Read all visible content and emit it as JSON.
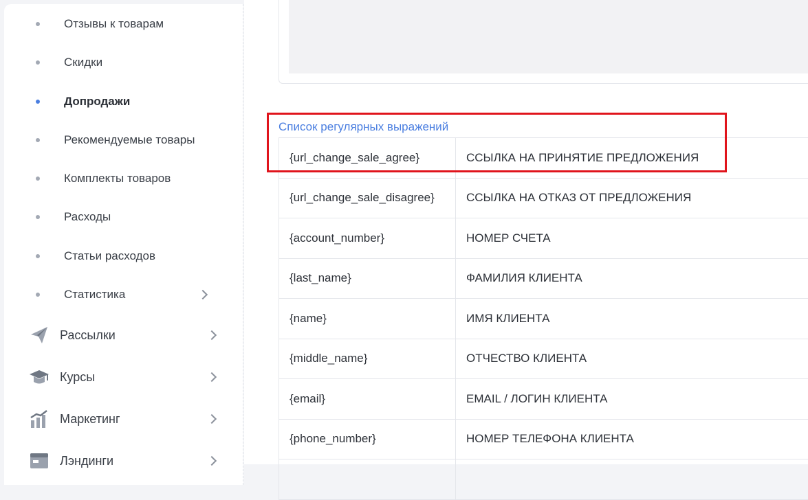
{
  "sidebar": {
    "subitems": [
      {
        "label": "Отзывы к товарам",
        "active": false
      },
      {
        "label": "Скидки",
        "active": false
      },
      {
        "label": "Допродажи",
        "active": true
      },
      {
        "label": "Рекомендуемые товары",
        "active": false
      },
      {
        "label": "Комплекты товаров",
        "active": false
      },
      {
        "label": "Расходы",
        "active": false
      },
      {
        "label": "Статьи расходов",
        "active": false
      },
      {
        "label": "Статистика",
        "active": false
      }
    ],
    "sections": [
      {
        "label": "Рассылки",
        "icon": "paper-plane-icon"
      },
      {
        "label": "Курсы",
        "icon": "graduation-cap-icon"
      },
      {
        "label": "Маркетинг",
        "icon": "bar-chart-icon"
      },
      {
        "label": "Лэндинги",
        "icon": "browser-window-icon"
      }
    ]
  },
  "main": {
    "regex_title": "Список регулярных выражений",
    "rows": [
      {
        "var": "{url_change_sale_agree}",
        "desc": "ССЫЛКА НА ПРИНЯТИЕ ПРЕДЛОЖЕНИЯ"
      },
      {
        "var": "{url_change_sale_disagree}",
        "desc": "ССЫЛКА НА ОТКАЗ ОТ ПРЕДЛОЖЕНИЯ"
      },
      {
        "var": "{account_number}",
        "desc": "НОМЕР СЧЕТА"
      },
      {
        "var": "{last_name}",
        "desc": "ФАМИЛИЯ КЛИЕНТА"
      },
      {
        "var": "{name}",
        "desc": "ИМЯ КЛИЕНТА"
      },
      {
        "var": "{middle_name}",
        "desc": "ОТЧЕСТВО КЛИЕНТА"
      },
      {
        "var": "{email}",
        "desc": "EMAIL / ЛОГИН КЛИЕНТА"
      },
      {
        "var": "{phone_number}",
        "desc": "НОМЕР ТЕЛЕФОНА КЛИЕНТА"
      },
      {
        "var": "",
        "desc": ""
      }
    ]
  },
  "colors": {
    "accent": "#4a7ee0",
    "highlight": "#e0141c"
  }
}
